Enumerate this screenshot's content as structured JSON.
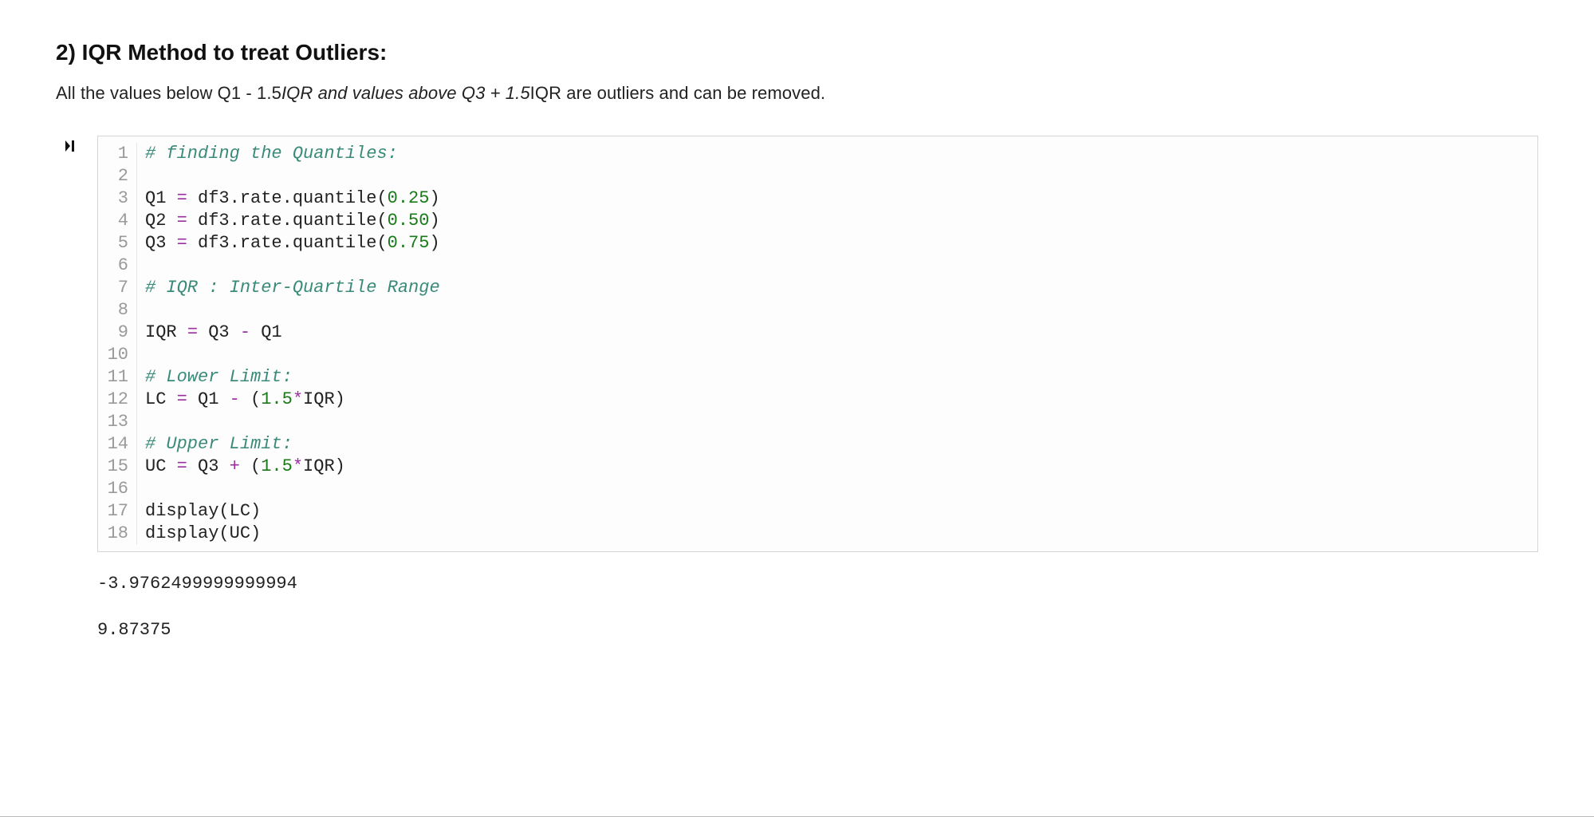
{
  "heading": "2) IQR Method to treat Outliers:",
  "description_plain_prefix": "All the values below Q1 - 1.5",
  "description_italic_middle": "IQR and values above Q3 + 1.5",
  "description_plain_suffix": "IQR are outliers and can be removed.",
  "code": {
    "lines": [
      {
        "n": "1",
        "tokens": [
          {
            "cls": "c-cmt",
            "t": "# finding the Quantiles:"
          }
        ]
      },
      {
        "n": "2",
        "tokens": []
      },
      {
        "n": "3",
        "tokens": [
          {
            "cls": "c-id",
            "t": "Q1 "
          },
          {
            "cls": "c-op",
            "t": "="
          },
          {
            "cls": "c-id",
            "t": " df3.rate.quantile("
          },
          {
            "cls": "c-num",
            "t": "0.25"
          },
          {
            "cls": "c-id",
            "t": ")"
          }
        ]
      },
      {
        "n": "4",
        "tokens": [
          {
            "cls": "c-id",
            "t": "Q2 "
          },
          {
            "cls": "c-op",
            "t": "="
          },
          {
            "cls": "c-id",
            "t": " df3.rate.quantile("
          },
          {
            "cls": "c-num",
            "t": "0.50"
          },
          {
            "cls": "c-id",
            "t": ")"
          }
        ]
      },
      {
        "n": "5",
        "tokens": [
          {
            "cls": "c-id",
            "t": "Q3 "
          },
          {
            "cls": "c-op",
            "t": "="
          },
          {
            "cls": "c-id",
            "t": " df3.rate.quantile("
          },
          {
            "cls": "c-num",
            "t": "0.75"
          },
          {
            "cls": "c-id",
            "t": ")"
          }
        ]
      },
      {
        "n": "6",
        "tokens": []
      },
      {
        "n": "7",
        "tokens": [
          {
            "cls": "c-cmt",
            "t": "# IQR : Inter-Quartile Range"
          }
        ]
      },
      {
        "n": "8",
        "tokens": []
      },
      {
        "n": "9",
        "tokens": [
          {
            "cls": "c-id",
            "t": "IQR "
          },
          {
            "cls": "c-op",
            "t": "="
          },
          {
            "cls": "c-id",
            "t": " Q3 "
          },
          {
            "cls": "c-op",
            "t": "-"
          },
          {
            "cls": "c-id",
            "t": " Q1"
          }
        ]
      },
      {
        "n": "10",
        "tokens": []
      },
      {
        "n": "11",
        "tokens": [
          {
            "cls": "c-cmt",
            "t": "# Lower Limit:"
          }
        ]
      },
      {
        "n": "12",
        "tokens": [
          {
            "cls": "c-id",
            "t": "LC "
          },
          {
            "cls": "c-op",
            "t": "="
          },
          {
            "cls": "c-id",
            "t": " Q1 "
          },
          {
            "cls": "c-op",
            "t": "-"
          },
          {
            "cls": "c-id",
            "t": " ("
          },
          {
            "cls": "c-num",
            "t": "1.5"
          },
          {
            "cls": "c-op",
            "t": "*"
          },
          {
            "cls": "c-id",
            "t": "IQR)"
          }
        ]
      },
      {
        "n": "13",
        "tokens": []
      },
      {
        "n": "14",
        "tokens": [
          {
            "cls": "c-cmt",
            "t": "# Upper Limit:"
          }
        ]
      },
      {
        "n": "15",
        "tokens": [
          {
            "cls": "c-id",
            "t": "UC "
          },
          {
            "cls": "c-op",
            "t": "="
          },
          {
            "cls": "c-id",
            "t": " Q3 "
          },
          {
            "cls": "c-op",
            "t": "+"
          },
          {
            "cls": "c-id",
            "t": " ("
          },
          {
            "cls": "c-num",
            "t": "1.5"
          },
          {
            "cls": "c-op",
            "t": "*"
          },
          {
            "cls": "c-id",
            "t": "IQR)"
          }
        ]
      },
      {
        "n": "16",
        "tokens": []
      },
      {
        "n": "17",
        "tokens": [
          {
            "cls": "c-id",
            "t": "display(LC)"
          }
        ]
      },
      {
        "n": "18",
        "tokens": [
          {
            "cls": "c-id",
            "t": "display(UC)"
          }
        ]
      }
    ]
  },
  "output": [
    "-3.9762499999999994",
    "9.87375"
  ]
}
